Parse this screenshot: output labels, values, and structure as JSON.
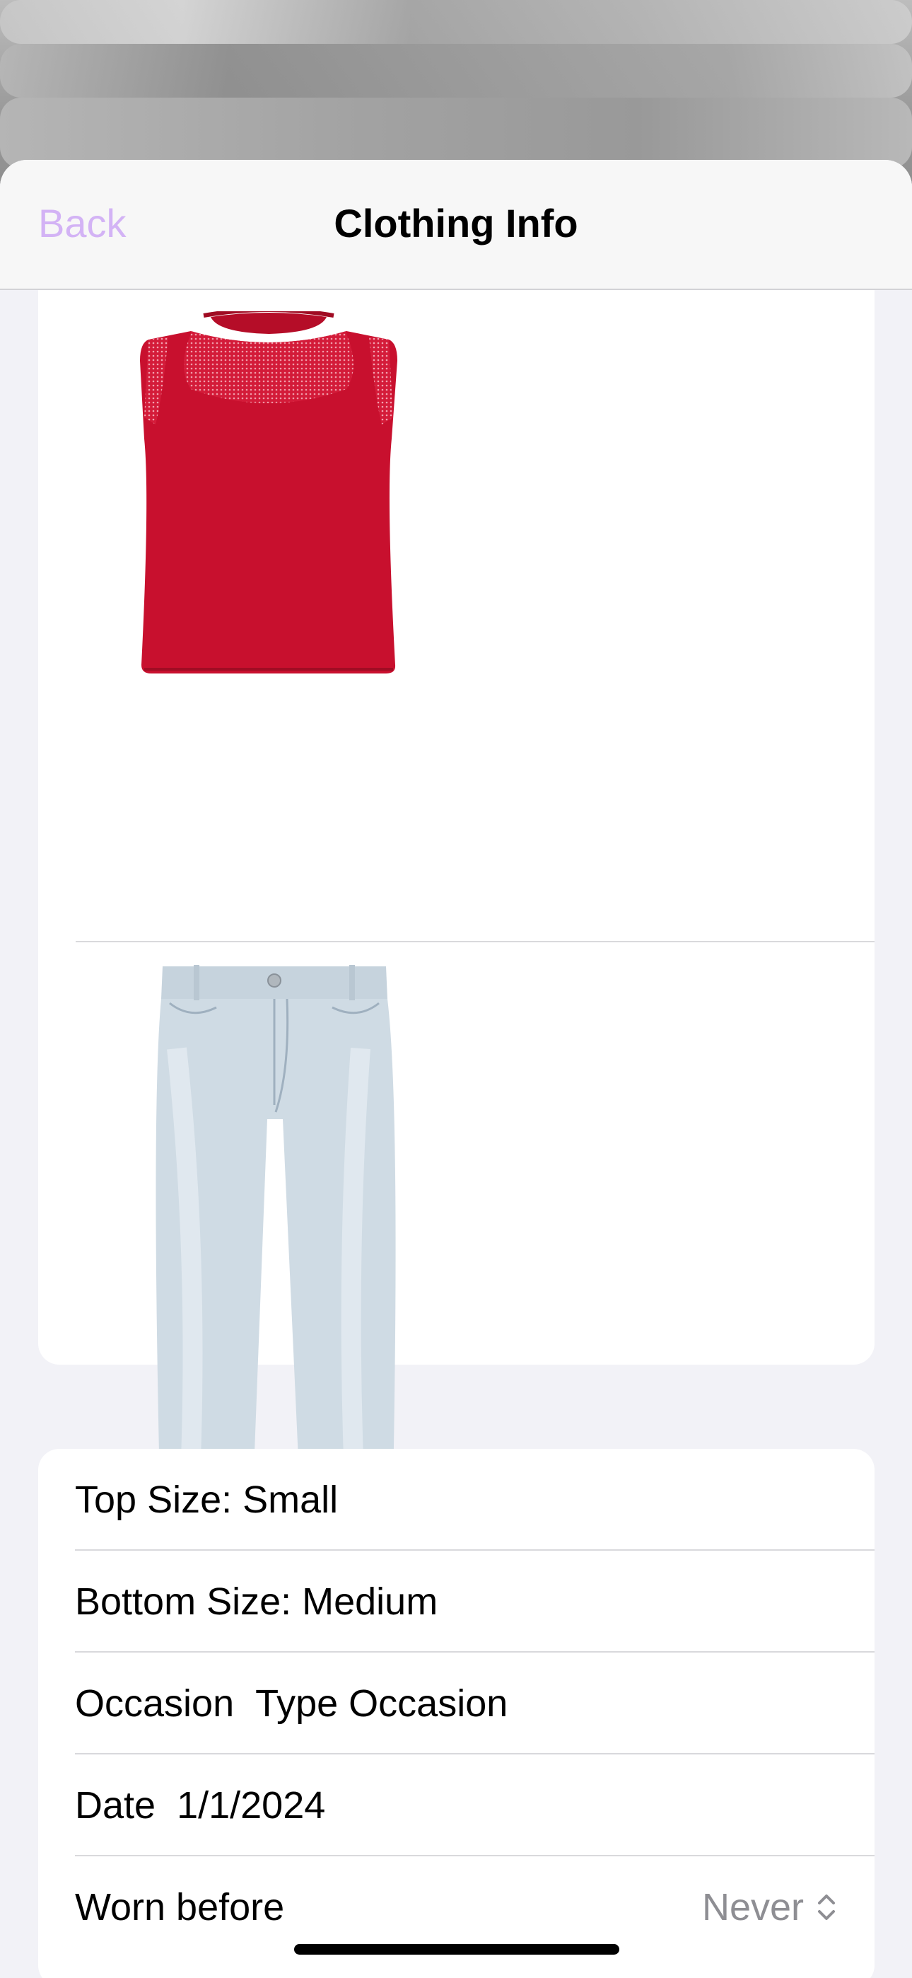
{
  "nav": {
    "back_label": "Back",
    "title": "Clothing Info"
  },
  "images": {
    "top_icon": "red-sleeveless-top-image",
    "bottom_icon": "light-wash-jeans-image"
  },
  "info": {
    "top_size": "Top Size: Small",
    "bottom_size": "Bottom Size: Medium",
    "occasion_label": "Occasion",
    "occasion_value": "Type Occasion",
    "date_label": "Date",
    "date_value": "1/1/2024",
    "worn_label": "Worn before",
    "worn_value": "Never"
  },
  "colors": {
    "accent": "#d3b3f5",
    "top_garment": "#c8102e",
    "jeans": "#cdd9e2"
  }
}
